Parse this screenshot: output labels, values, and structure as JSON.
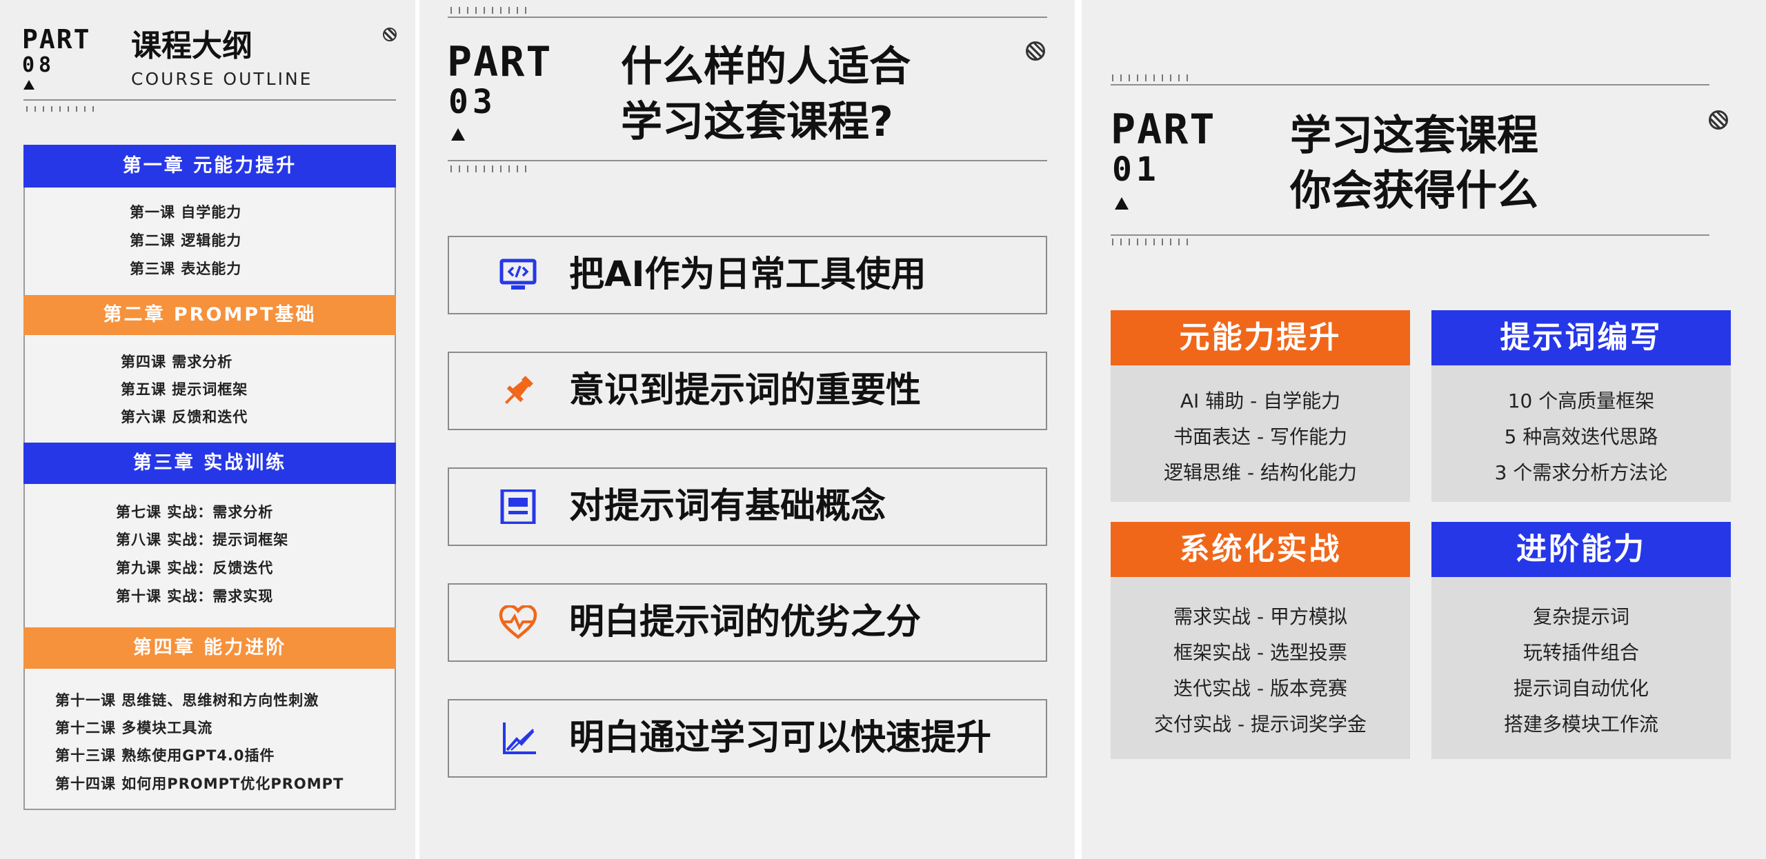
{
  "colors": {
    "blue": "#2637e8",
    "orange": "#f6913c",
    "orange_dark": "#f0671a"
  },
  "outline": {
    "part_word": "PART",
    "part_num": "08",
    "title": "课程大纲",
    "subtitle": "COURSE OUTLINE",
    "chapters": [
      {
        "title": "第一章  元能力提升",
        "lessons": [
          "第一课  自学能力",
          "第二课  逻辑能力",
          "第三课  表达能力"
        ]
      },
      {
        "title": "第二章  PROMPT基础",
        "lessons": [
          "第四课  需求分析",
          "第五课  提示词框架",
          "第六课  反馈和迭代"
        ]
      },
      {
        "title": "第三章  实战训练",
        "lessons": [
          "第七课  实战：需求分析",
          "第八课  实战：提示词框架",
          "第九课  实战：反馈迭代",
          "第十课  实战：需求实现"
        ]
      },
      {
        "title": "第四章  能力进阶",
        "lessons": [
          "第十一课  思维链、思维树和方向性刺激",
          "第十二课  多模块工具流",
          "第十三课  熟练使用GPT4.0插件",
          "第十四课  如何用PROMPT优化PROMPT"
        ]
      }
    ]
  },
  "audience": {
    "part_word": "PART",
    "part_num": "03",
    "title_line1": "什么样的人适合",
    "title_line2": "学习这套课程?",
    "items": [
      {
        "icon": "code-monitor-icon",
        "text": "把AI作为日常工具使用"
      },
      {
        "icon": "pin-icon",
        "text": "意识到提示词的重要性"
      },
      {
        "icon": "article-icon",
        "text": "对提示词有基础概念"
      },
      {
        "icon": "heartbeat-icon",
        "text": "明白提示词的优劣之分"
      },
      {
        "icon": "growth-chart-icon",
        "text": "明白通过学习可以快速提升"
      }
    ]
  },
  "gains": {
    "part_word": "PART",
    "part_num": "01",
    "title_line1": "学习这套课程",
    "title_line2": "你会获得什么",
    "cards": [
      {
        "title": "元能力提升",
        "color": "orange",
        "lines": [
          "AI 辅助 - 自学能力",
          "书面表达 - 写作能力",
          "逻辑思维 - 结构化能力"
        ]
      },
      {
        "title": "提示词编写",
        "color": "blue",
        "lines": [
          "10 个高质量框架",
          "5 种高效迭代思路",
          "3 个需求分析方法论"
        ]
      },
      {
        "title": "系统化实战",
        "color": "orange",
        "lines": [
          "需求实战 - 甲方模拟",
          "框架实战 - 选型投票",
          "迭代实战 - 版本竞赛",
          "交付实战 - 提示词奖学金"
        ]
      },
      {
        "title": "进阶能力",
        "color": "blue",
        "lines": [
          "复杂提示词",
          "玩转插件组合",
          "提示词自动优化",
          "搭建多模块工作流"
        ]
      }
    ]
  }
}
